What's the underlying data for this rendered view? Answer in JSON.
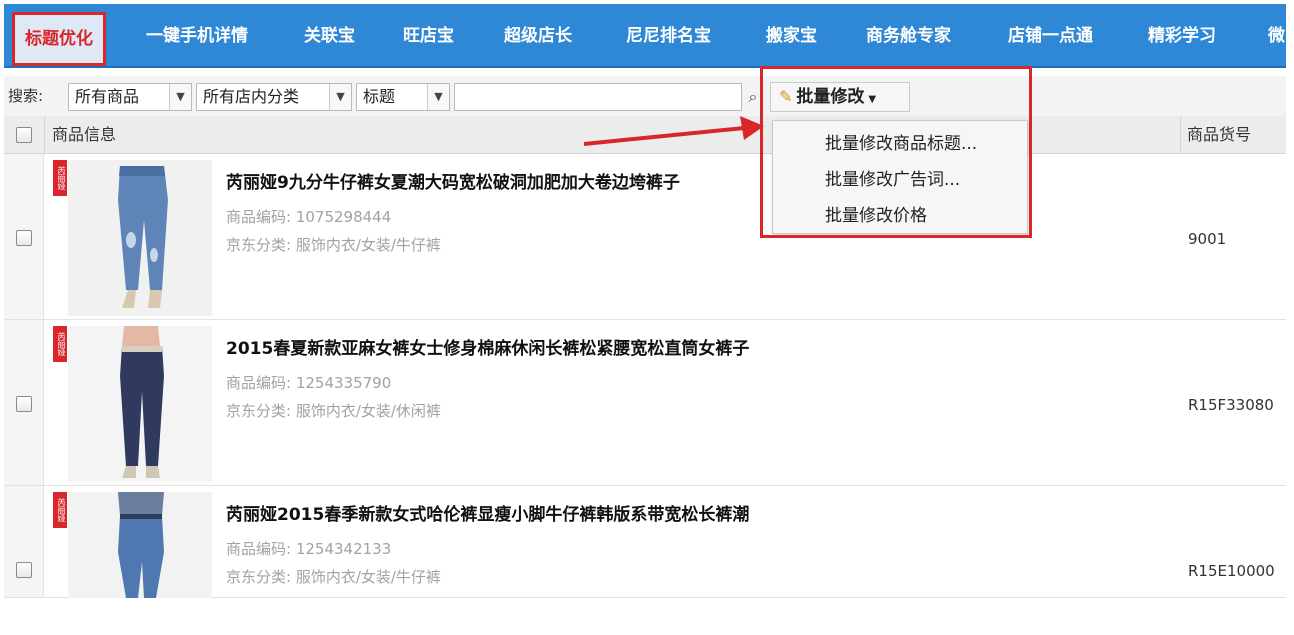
{
  "nav": {
    "tabs": [
      {
        "label": "标题优化",
        "active": true
      },
      {
        "label": "一键手机详情"
      },
      {
        "label": "关联宝"
      },
      {
        "label": "旺店宝"
      },
      {
        "label": "超级店长"
      },
      {
        "label": "尼尼排名宝"
      },
      {
        "label": "搬家宝"
      },
      {
        "label": "商务舱专家"
      },
      {
        "label": "店铺一点通"
      },
      {
        "label": "精彩学习"
      },
      {
        "label": "微"
      }
    ]
  },
  "toolbar": {
    "search_label": "搜索:",
    "filter1": "所有商品",
    "filter2": "所有店内分类",
    "filter3": "标题",
    "search_value": "",
    "batch_label": "批量修改"
  },
  "table": {
    "headers": {
      "info": "商品信息",
      "sku": "商品货号"
    },
    "rows": [
      {
        "title": "芮丽娅9九分牛仔裤女夏潮大码宽松破洞加肥加大卷边垮裤子",
        "code": "商品编码: 1075298444",
        "category": "京东分类: 服饰内衣/女装/牛仔裤",
        "sku": "9001",
        "badge": "芮丽娅"
      },
      {
        "title": "2015春夏新款亚麻女裤女士修身棉麻休闲长裤松紧腰宽松直筒女裤子",
        "code": "商品编码: 1254335790",
        "category": "京东分类: 服饰内衣/女装/休闲裤",
        "sku": "R15F33080",
        "badge": "芮丽娅"
      },
      {
        "title": "芮丽娅2015春季新款女式哈伦裤显瘦小脚牛仔裤韩版系带宽松长裤潮",
        "code": "商品编码: 1254342133",
        "category": "京东分类: 服饰内衣/女装/牛仔裤",
        "sku": "R15E10000",
        "badge": "芮丽娅"
      }
    ]
  },
  "dropdown": {
    "items": [
      "批量修改商品标题...",
      "批量修改广告词...",
      "批量修改价格"
    ]
  },
  "colors": {
    "nav_bg": "#2e88d6",
    "highlight": "#d8262a"
  }
}
